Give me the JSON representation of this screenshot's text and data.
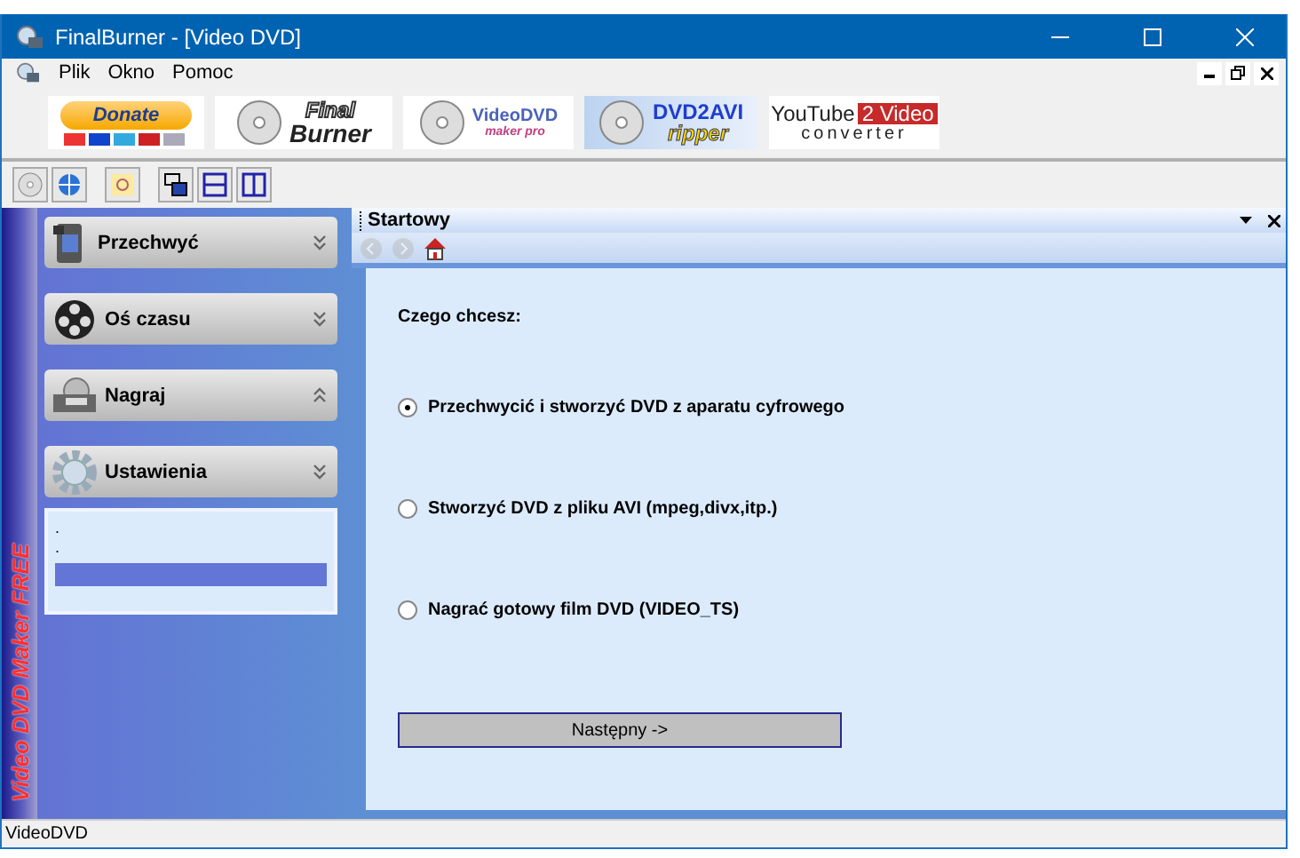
{
  "window": {
    "title": "FinalBurner - [Video DVD]"
  },
  "menu": [
    "Plik",
    "Okno",
    "Pomoc"
  ],
  "banners": [
    {
      "kind": "donate",
      "lines": [
        "Donate"
      ]
    },
    {
      "kind": "finalburner",
      "lines": [
        "Final",
        "Burner"
      ]
    },
    {
      "kind": "videodvd",
      "lines": [
        "VideoDVD",
        "maker pro"
      ]
    },
    {
      "kind": "dvd2avi",
      "lines": [
        "DVD2AVI",
        "ripper"
      ]
    },
    {
      "kind": "youtube",
      "lines": [
        "YouTube",
        "2 Video",
        "converter"
      ]
    }
  ],
  "side_caption": "Video DVD Maker FREE",
  "sidebar": {
    "groups": [
      {
        "label": "Przechwyć",
        "kind": "camera",
        "expanded": false
      },
      {
        "label": "Oś czasu",
        "kind": "film",
        "expanded": false
      },
      {
        "label": "Nagraj",
        "kind": "dvd",
        "expanded": true
      },
      {
        "label": "Ustawienia",
        "kind": "gear",
        "expanded": false
      }
    ],
    "sub_items": [
      ".",
      "."
    ]
  },
  "panel": {
    "title": "Startowy",
    "question": "Czego chcesz:",
    "options": [
      {
        "label": "Przechwycić i stworzyć DVD z aparatu cyfrowego",
        "selected": true
      },
      {
        "label": "Stworzyć DVD z pliku AVI (mpeg,divx,itp.)",
        "selected": false
      },
      {
        "label": "Nagrać gotowy film DVD (VIDEO_TS)",
        "selected": false
      }
    ],
    "next_button": "Następny ->"
  },
  "status_bar": "VideoDVD"
}
